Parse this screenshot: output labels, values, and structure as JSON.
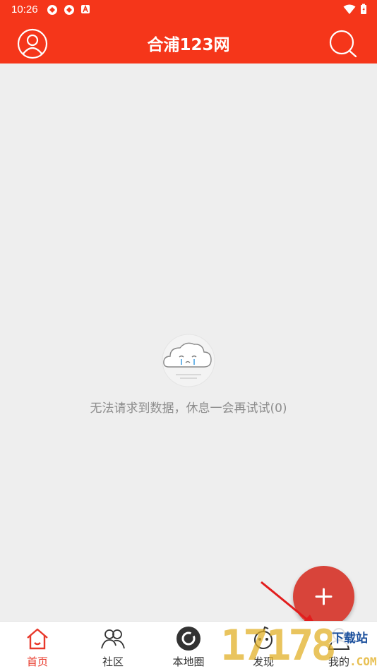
{
  "status_bar": {
    "time": "10:26"
  },
  "header": {
    "title": "合浦123网"
  },
  "empty_state": {
    "message": "无法请求到数据，休息一会再试试(0)"
  },
  "fab": {
    "icon": "plus-icon"
  },
  "tabs": [
    {
      "label": "首页",
      "icon": "home-icon",
      "active": true
    },
    {
      "label": "社区",
      "icon": "community-icon",
      "active": false
    },
    {
      "label": "本地圈",
      "icon": "local-circle-icon",
      "active": false
    },
    {
      "label": "发现",
      "icon": "discover-icon",
      "active": false
    },
    {
      "label": "我的",
      "icon": "profile-icon",
      "active": false
    }
  ],
  "watermark": {
    "number": "17178",
    "label": "下载站",
    "suffix": ".COM"
  },
  "colors": {
    "brand": "#f5361a",
    "fab": "#d8443a",
    "active_tab": "#e8382a",
    "background": "#eeeeee"
  }
}
